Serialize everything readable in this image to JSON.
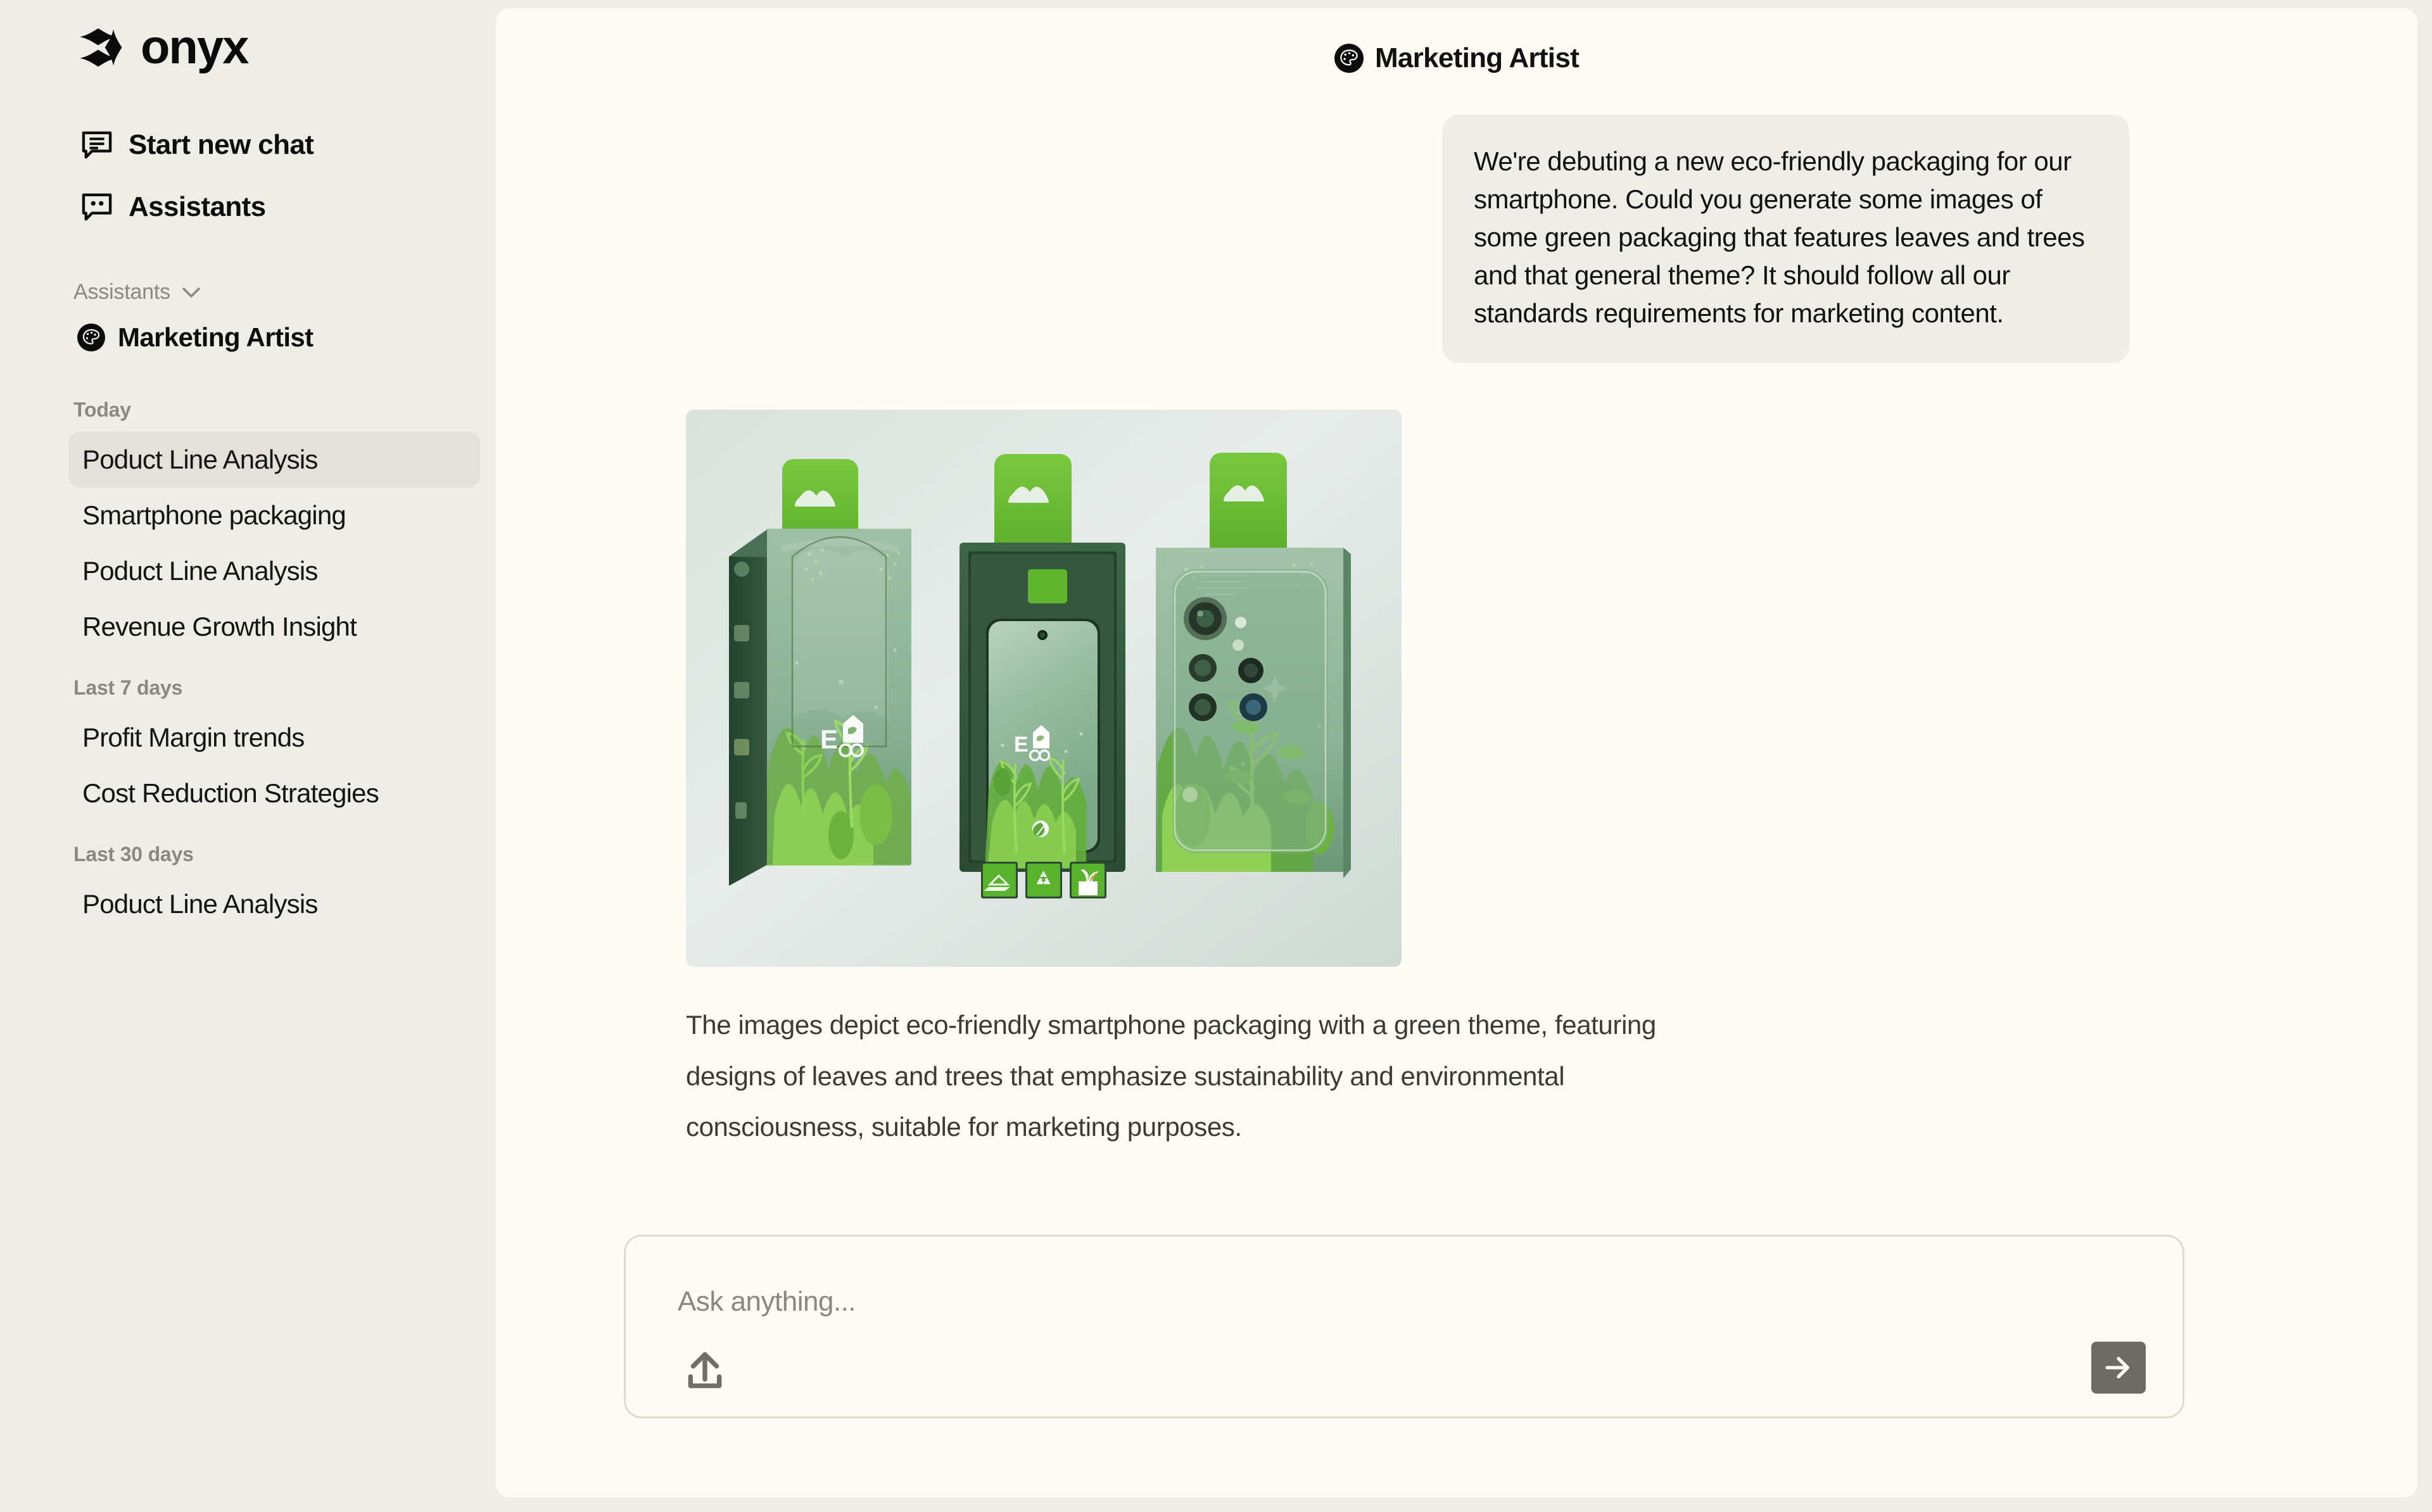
{
  "app": {
    "brand": "onyx",
    "brand_icon": "onyx-logo-icon"
  },
  "sidebar": {
    "nav": [
      {
        "label": "Start new chat",
        "icon": "new-chat-icon"
      },
      {
        "label": "Assistants",
        "icon": "assistants-chat-icon"
      }
    ],
    "assistants_section": {
      "label": "Assistants",
      "chevron_icon": "chevron-down-icon",
      "items": [
        {
          "label": "Marketing Artist",
          "icon": "palette-avatar-icon"
        }
      ]
    },
    "history": [
      {
        "group": "Today",
        "items": [
          {
            "label": "Poduct Line Analysis",
            "active": true
          },
          {
            "label": "Smartphone packaging",
            "active": false
          },
          {
            "label": "Poduct Line Analysis",
            "active": false
          },
          {
            "label": "Revenue Growth Insight",
            "active": false
          }
        ]
      },
      {
        "group": "Last 7 days",
        "items": [
          {
            "label": "Profit Margin trends",
            "active": false
          },
          {
            "label": "Cost Reduction Strategies",
            "active": false
          }
        ]
      },
      {
        "group": "Last 30 days",
        "items": [
          {
            "label": "Poduct Line Analysis",
            "active": false
          }
        ]
      }
    ]
  },
  "chat": {
    "header": {
      "title": "Marketing Artist",
      "avatar_icon": "palette-avatar-icon"
    },
    "user_message": "We're debuting a new eco-friendly packaging for our smartphone. Could you generate some images of some green packaging that features leaves and trees and that general theme? It should follow all our standards requirements for marketing content.",
    "assistant_image_alt": "Three eco-friendly green smartphone packaging boxes with leaves and trees artwork",
    "assistant_image_labels": {
      "box_logo": "E",
      "badge_1": "leaf-badge-icon",
      "badge_2": "recycle-badge-icon",
      "badge_3": "plant-badge-icon"
    },
    "assistant_message": "The images depict eco-friendly smartphone packaging with a green theme, featuring designs of leaves and trees that emphasize sustainability and environmental consciousness, suitable for marketing purposes."
  },
  "composer": {
    "placeholder": "Ask anything...",
    "upload_icon": "upload-icon",
    "send_icon": "arrow-right-icon"
  },
  "colors": {
    "sidebar_bg": "#EFEDE8",
    "panel_bg": "#FDFBF4",
    "bubble_bg": "#EFEDE8",
    "active_item_bg": "#E4E1DA",
    "muted_text": "#8C8880",
    "send_button_bg": "#6C6B66",
    "eco_green": "#55B12A"
  }
}
